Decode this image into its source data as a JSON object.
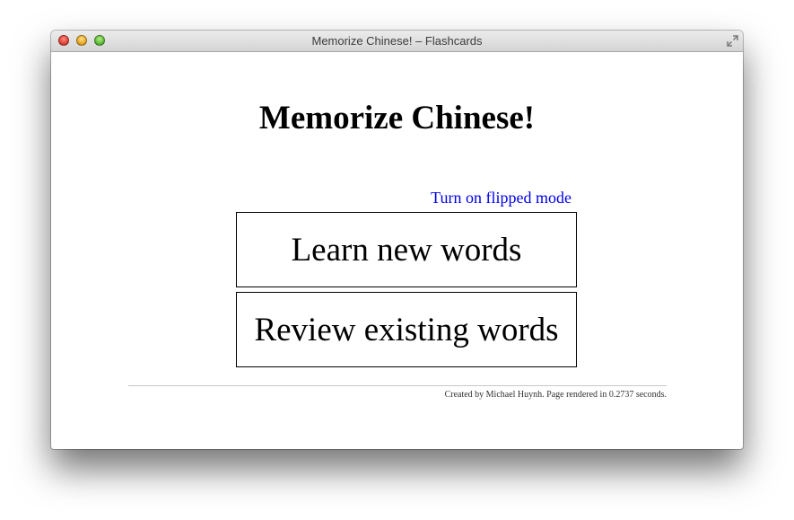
{
  "window": {
    "title": "Memorize Chinese! – Flashcards"
  },
  "page": {
    "heading": "Memorize Chinese!",
    "flip_link": "Turn on flipped mode",
    "learn_button": "Learn new words",
    "review_button": "Review existing words",
    "footer": "Created by Michael Huynh. Page rendered in 0.2737 seconds."
  },
  "colors": {
    "link": "#0000ee",
    "text": "#000000",
    "border": "#000000"
  },
  "icons": {
    "close": "close-icon",
    "minimize": "minimize-icon",
    "zoom": "zoom-icon",
    "fullscreen": "fullscreen-icon"
  }
}
